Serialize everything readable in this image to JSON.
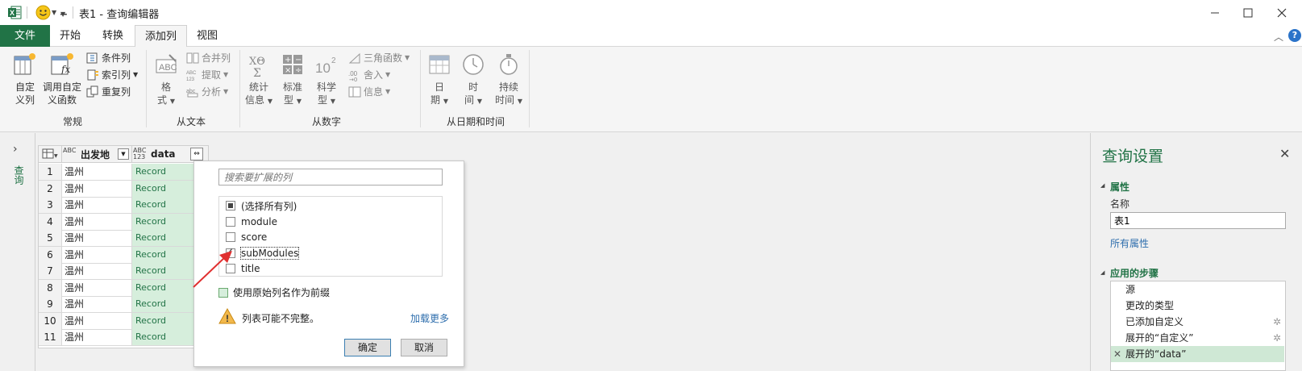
{
  "window": {
    "title": "表1 - 查询编辑器",
    "minimize_icon": "minimize-icon",
    "maximize_icon": "maximize-icon",
    "close_icon": "close-icon"
  },
  "tabs": [
    {
      "label": "文件"
    },
    {
      "label": "开始"
    },
    {
      "label": "转换"
    },
    {
      "label": "添加列"
    },
    {
      "label": "视图"
    }
  ],
  "ribbon": {
    "groups": {
      "general": "常规",
      "from_text": "从文本",
      "from_number": "从数字",
      "from_datetime": "从日期和时间"
    },
    "custom_column": [
      "自定",
      "义列"
    ],
    "invoke_function": [
      "调用自定",
      "义函数"
    ],
    "conditional_column": "条件列",
    "index_column": "索引列",
    "duplicate_column": "重复列",
    "format": [
      "格",
      "式"
    ],
    "merge_columns": "合并列",
    "extract": "提取",
    "parse": "分析",
    "statistics": [
      "统计",
      "信息"
    ],
    "standard": [
      "标准",
      "型"
    ],
    "scientific": [
      "科学",
      "型"
    ],
    "trigonometry": "三角函数",
    "rounding": "舍入",
    "information": "信息",
    "date": [
      "日",
      "期"
    ],
    "time": [
      "时",
      "间"
    ],
    "duration": [
      "持续",
      "时间"
    ]
  },
  "leftnav": {
    "label": "查询"
  },
  "grid": {
    "columns": [
      {
        "type": "ABC",
        "name": "出发地"
      },
      {
        "type": "ABC 123",
        "name": "data"
      }
    ],
    "rows": [
      {
        "n": "1",
        "origin": "温州",
        "data": "Record"
      },
      {
        "n": "2",
        "origin": "温州",
        "data": "Record"
      },
      {
        "n": "3",
        "origin": "温州",
        "data": "Record"
      },
      {
        "n": "4",
        "origin": "温州",
        "data": "Record"
      },
      {
        "n": "5",
        "origin": "温州",
        "data": "Record"
      },
      {
        "n": "6",
        "origin": "温州",
        "data": "Record"
      },
      {
        "n": "7",
        "origin": "温州",
        "data": "Record"
      },
      {
        "n": "8",
        "origin": "温州",
        "data": "Record"
      },
      {
        "n": "9",
        "origin": "温州",
        "data": "Record"
      },
      {
        "n": "10",
        "origin": "温州",
        "data": "Record"
      },
      {
        "n": "11",
        "origin": "温州",
        "data": "Record"
      }
    ]
  },
  "expand_popup": {
    "search_placeholder": "搜索要扩展的列",
    "options": [
      {
        "label": "(选择所有列)",
        "state": "partial"
      },
      {
        "label": "module",
        "state": "unchecked"
      },
      {
        "label": "score",
        "state": "unchecked"
      },
      {
        "label": "subModules",
        "state": "checked"
      },
      {
        "label": "title",
        "state": "unchecked"
      }
    ],
    "use_prefix_label": "使用原始列名作为前缀",
    "use_prefix_checked": false,
    "warning": "列表可能不完整。",
    "load_more": "加载更多",
    "ok": "确定",
    "cancel": "取消"
  },
  "settings": {
    "title": "查询设置",
    "properties_header": "属性",
    "name_label": "名称",
    "name_value": "表1",
    "all_properties": "所有属性",
    "steps_header": "应用的步骤",
    "steps": [
      {
        "label": "源",
        "gear": false,
        "selected": false
      },
      {
        "label": "更改的类型",
        "gear": false,
        "selected": false
      },
      {
        "label": "已添加自定义",
        "gear": true,
        "selected": false
      },
      {
        "label": "展开的“自定义”",
        "gear": true,
        "selected": false
      },
      {
        "label": "展开的“data”",
        "gear": false,
        "selected": true
      }
    ]
  },
  "colors": {
    "accent_green": "#217346",
    "data_col_bg": "#d6eedc",
    "link_blue": "#2e6ead",
    "selected_step": "#cfe8d5",
    "arrow_red": "#e03030"
  }
}
